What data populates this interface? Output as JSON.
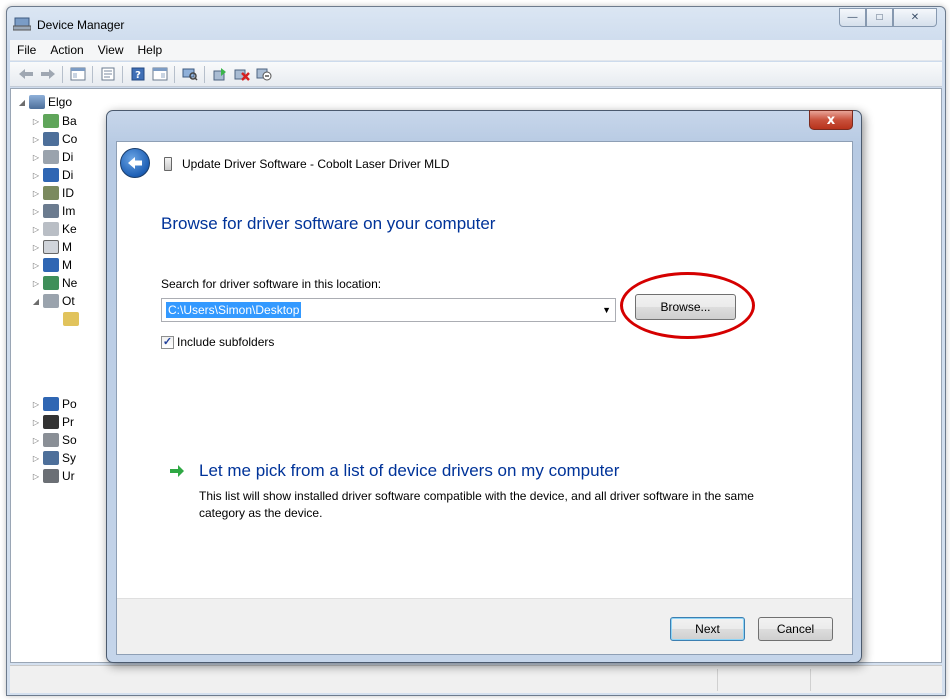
{
  "window": {
    "title": "Device Manager",
    "menu": [
      "File",
      "Action",
      "View",
      "Help"
    ],
    "caption_buttons": [
      "minimize-icon",
      "maximize-icon",
      "close-icon"
    ]
  },
  "toolbar": {
    "icons": [
      "back-arrow-icon",
      "forward-arrow-icon",
      "show-hide-console-tree-icon",
      "properties-icon",
      "help-icon",
      "action-pane-icon",
      "scan-hardware-icon",
      "update-driver-icon",
      "uninstall-icon",
      "disable-icon"
    ]
  },
  "tree": {
    "root": "Elgo",
    "items": [
      {
        "label": "Ba",
        "expanded": false
      },
      {
        "label": "Co",
        "expanded": false
      },
      {
        "label": "Di",
        "expanded": false
      },
      {
        "label": "Di",
        "expanded": false
      },
      {
        "label": "ID",
        "expanded": false
      },
      {
        "label": "Im",
        "expanded": false
      },
      {
        "label": "Ke",
        "expanded": false
      },
      {
        "label": "M",
        "expanded": false
      },
      {
        "label": "M",
        "expanded": false
      },
      {
        "label": "Ne",
        "expanded": false
      },
      {
        "label": "Ot",
        "expanded": true
      },
      {
        "label": "",
        "expanded": false
      },
      {
        "label": "Po",
        "expanded": false
      },
      {
        "label": "Pr",
        "expanded": false
      },
      {
        "label": "So",
        "expanded": false
      },
      {
        "label": "Sy",
        "expanded": false
      },
      {
        "label": "Ur",
        "expanded": false
      }
    ]
  },
  "wizard": {
    "title": "Update Driver Software - Cobolt Laser Driver MLD",
    "close_label": "x",
    "heading": "Browse for driver software on your computer",
    "search_label": "Search for driver software in this location:",
    "path_value": "C:\\Users\\Simon\\Desktop",
    "browse_label": "Browse...",
    "include_subfolders_label": "Include subfolders",
    "include_subfolders_checked": true,
    "pick_link": "Let me pick from a list of device drivers on my computer",
    "pick_desc": "This list will show installed driver software compatible with the device, and all driver software in the same category as the device.",
    "next_label": "Next",
    "cancel_label": "Cancel"
  },
  "colors": {
    "heading_blue": "#003399",
    "selection_blue": "#3399ff",
    "highlight_red": "#d50000"
  }
}
